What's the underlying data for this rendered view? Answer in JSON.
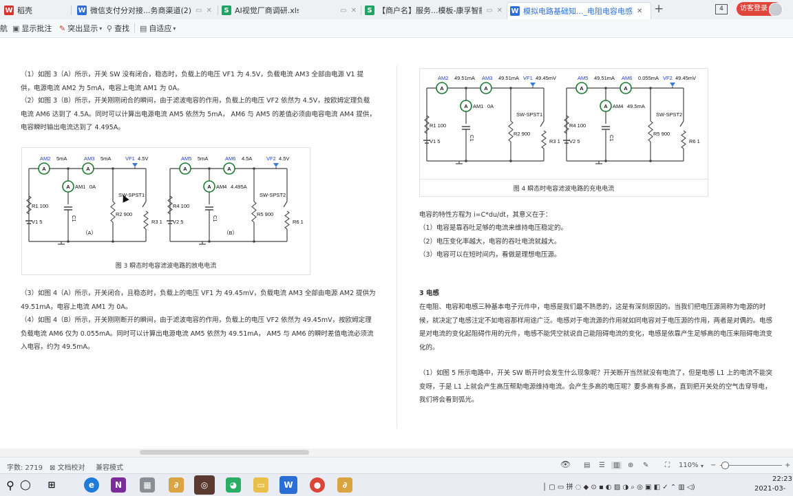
{
  "tabs": [
    {
      "label": "稻壳",
      "icon": "wps-logo-icon",
      "color": "#d9342b",
      "glyph": "W"
    },
    {
      "label": "微信支付分对接...务商渠道(2)",
      "icon": "word-doc-icon",
      "color": "#2b6fd6",
      "glyph": "W"
    },
    {
      "label": "AI视觉厂商调研.xls",
      "icon": "excel-sheet-icon",
      "color": "#21a366",
      "glyph": "S"
    },
    {
      "label": "【商户名】服务...模板-康孚智能",
      "icon": "excel-sheet-icon",
      "color": "#21a366",
      "glyph": "S"
    },
    {
      "label": "模拟电路基础知..._电阻电容电感",
      "icon": "word-doc-icon",
      "color": "#2b6fd6",
      "glyph": "W"
    }
  ],
  "tabbar_right": {
    "new_tab": "+",
    "count": "4",
    "login": "访客登录"
  },
  "toolbar": {
    "nav": "航",
    "comments": "显示批注",
    "highlight": "突出显示",
    "find": "查找",
    "fit": "自适应"
  },
  "left_paras": [
    "（1）如图 3（A）所示，开关 SW 没有闭合，稳态时，负载上的电压 VF1 为 4.5V，负载电流 AM3 全部由电源 V1 提供，电源电流 AM2 为 5mA，电容上电流 AM1 为 0A。",
    "（2）如图 3（B）所示，开关刚刚闭合的瞬间，由于滤波电容的作用，负载上的电压 VF2 依然为 4.5V，按欧姆定理负载电流 AM6 达到了 4.5A。同时可以计算出电源电流 AM5 依然为 5mA， AM6 与 AM5 的差值必须由电容电流 AM4 提供，电容瞬时输出电流达到了 4.495A。",
    "（3）如图 4（A）所示，开关闭合，且稳态时，负载上的电压 VF1 为 49.45mV，负载电流 AM3 全部由电源 AM2 提供为 49.51mA，电容上电流 AM1 为 0A。",
    "（4）如图 4（B）所示，开关刚刚断开的瞬间，由于滤波电容的作用，负载上的电压 VF2 依然为 49.45mV，按欧姆定理负载电流 AM6 仅为 0.055mA。同时可以计算出电源电流 AM5 依然为 49.51mA， AM5 与 AM6 的瞬时差值电流必须流入电容，约为 49.5mA。"
  ],
  "fig3": {
    "caption": "图 3 瞬态时电容滤波电路的放电电流",
    "a": {
      "src_meter": "AM2",
      "src_val": "5mA",
      "load_meter": "AM3",
      "load_val": "5mA",
      "vf": "VF1",
      "vf_val": "4.5V",
      "cap_meter": "AM1",
      "cap_val": "0A",
      "r1": "R1 100",
      "vs": "V1 5",
      "r2": "R2 900",
      "sw": "SW-SPST1",
      "r3": "R3 1",
      "tag": "（A）"
    },
    "b": {
      "src_meter": "AM5",
      "src_val": "5mA",
      "load_meter": "AM6",
      "load_val": "4.5A",
      "vf": "VF2",
      "vf_val": "4.5V",
      "cap_meter": "AM4",
      "cap_val": "4.495A",
      "r1": "R4 100",
      "vs": "V2 5",
      "r2": "R5 900",
      "sw": "SW-SPST2",
      "r3": "R6 1",
      "tag": "（B）"
    },
    "cap_label": "C1"
  },
  "fig4": {
    "caption": "图 4 瞬态时电容滤波电路的充电电流",
    "a": {
      "src_meter": "AM2",
      "src_val": "49.51mA",
      "load_meter": "AM3",
      "load_val": "49.51mA",
      "vf": "VF1",
      "vf_val": "49.45mV",
      "cap_meter": "AM1",
      "cap_val": "0A",
      "r1": "R1 100",
      "vs": "V1 5",
      "r2": "R2 900",
      "sw": "SW-SPST1",
      "r3": "R3 1",
      "tag": ""
    },
    "b": {
      "src_meter": "AM5",
      "src_val": "49.51mA",
      "load_meter": "AM6",
      "load_val": "0.055mA",
      "vf": "VF2",
      "vf_val": "49.45mV",
      "cap_meter": "AM4",
      "cap_val": "49.5mA",
      "r1": "R4 100",
      "vs": "V2 5",
      "r2": "R5 900",
      "sw": "SW-SPST2",
      "r3": "R6 1",
      "tag": ""
    },
    "cap_label": "C1"
  },
  "right_paras": {
    "intro": "电容的特性方程为 i=C*du/dt，其意义在于：",
    "items": [
      "（1）电容是靠吞吐足够的电流来维持电压稳定的。",
      "（2）电压变化率越大，电容的吞吐电流就越大。",
      "（3）电容可以在短时间内，看做是理想电压源。"
    ],
    "heading": "3 电感",
    "body": "在电阻、电容和电感三种基本电子元件中，电感是我们最不熟悉的，这是有深刻原因的。当我们把电压源简称为电源的时候，就决定了电感注定不如电容那样用途广泛。电感对于电流源的作用就如同电容对于电压源的作用，两者是对偶的。电感是对电流的变化起阻碍作用的元件，电感不能凭空就说自己能阻碍电流的变化，电感是依靠产生足够高的电压来阻碍电流变化的。",
    "body2": "（1）如图 5 所示电路中，开关 SW 断开时会发生什么现象呢？开关断开当然就没有电流了，但是电感 L1 上的电流不能突变呀，于是 L1 上就会产生高压帮助电源维持电流。会产生多高的电压呢？要多高有多高，直到把开关处的空气击穿导电，我们将会看到弧光。"
  },
  "status": {
    "word_count": "字数: 2719",
    "proof": "文档校对",
    "compat": "兼容模式",
    "zoom": "110%",
    "minus": "−",
    "plus": "+"
  },
  "taskbar": {
    "time": "22:23",
    "date": "2021-03-"
  },
  "colors": {
    "wire": "#444444",
    "meter": "#1a7a2e",
    "label_blue": "#1f3fbf",
    "tabbar": "#eef0f3"
  }
}
